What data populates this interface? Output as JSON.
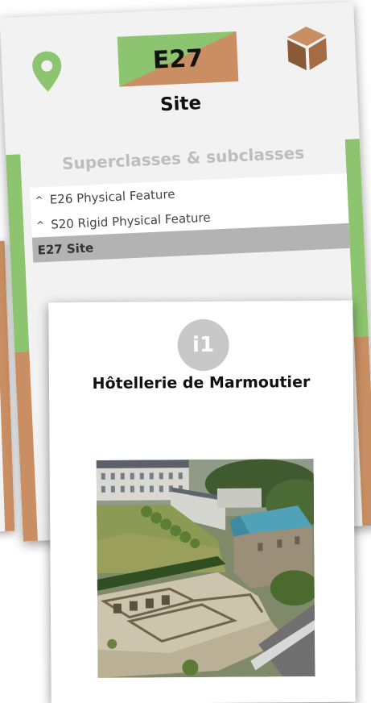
{
  "class_card": {
    "code": "E27",
    "name": "Site",
    "icons": {
      "left": "map-pin-icon",
      "right": "cube-icon"
    },
    "colors": {
      "green": "#8cc46f",
      "brown": "#c98f62",
      "card_bg": "#f2f2f2",
      "current_row": "#b3b3b3"
    },
    "hierarchy": {
      "title": "Superclasses & subclasses",
      "items": [
        {
          "caret": "^",
          "label": "E26 Physical Feature"
        },
        {
          "caret": "^",
          "label": "S20 Rigid Physical Feature"
        }
      ],
      "current": "E27 Site"
    }
  },
  "instance_card": {
    "badge": "i1",
    "name": "Hôtellerie de Marmoutier",
    "badge_color": "#c8c8c8"
  }
}
